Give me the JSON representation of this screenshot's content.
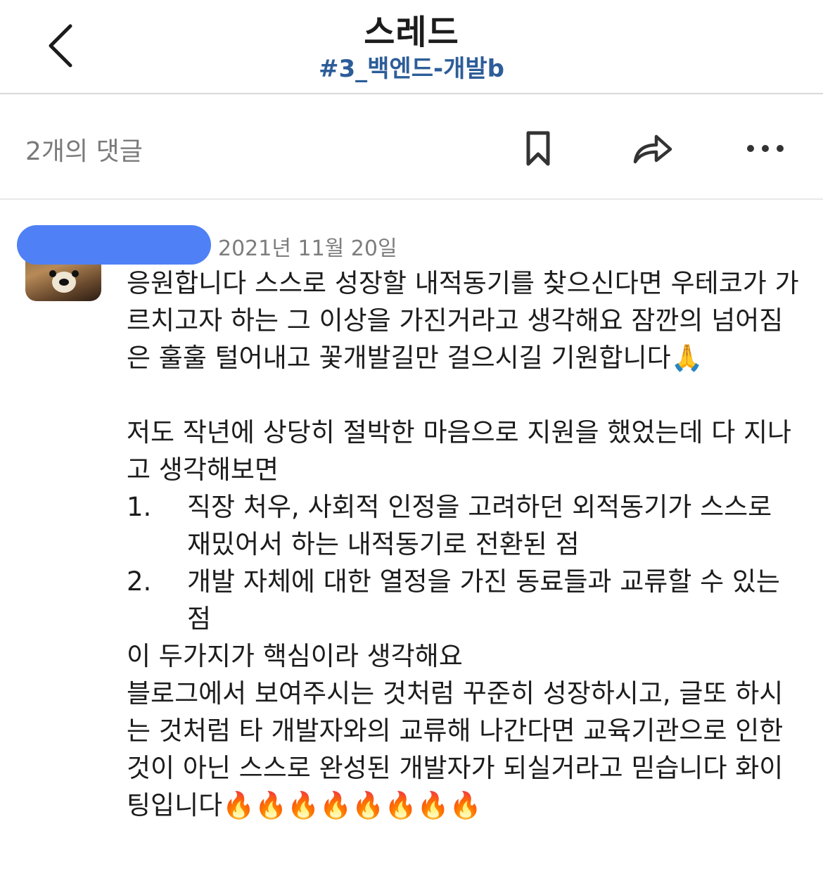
{
  "header": {
    "title": "스레드",
    "channel": "#3_백엔드-개발b"
  },
  "action_bar": {
    "reply_count": "2개의 댓글",
    "icons": [
      "bookmark-icon",
      "share-icon",
      "more-icon"
    ]
  },
  "message": {
    "timestamp": "2021년 11월 20일",
    "paragraph1": "응원합니다 스스로 성장할 내적동기를 찾으신다면 우테코가 가르치고자 하는 그 이상을 가진거라고 생각해요 잠깐의 넘어짐은 훌훌 털어내고 꽃개발길만 걸으시길 기원합니다🙏",
    "paragraph2": "저도 작년에 상당히 절박한 마음으로 지원을 했었는데 다 지나고 생각해보면",
    "list": [
      {
        "num": "1.",
        "text": "직장 처우, 사회적 인정을 고려하던 외적동기가 스스로 재밌어서 하는 내적동기로 전환된 점"
      },
      {
        "num": "2.",
        "text": "개발 자체에 대한 열정을 가진 동료들과 교류할 수 있는 점"
      }
    ],
    "paragraph3": "이 두가지가 핵심이라 생각해요",
    "paragraph4": "블로그에서 보여주시는 것처럼 꾸준히 성장하시고, 글또 하시는 것처럼 타 개발자와의 교류해 나간다면 교육기관으로 인한 것이 아닌 스스로 완성된 개발자가 되실거라고 믿습니다 화이팅입니다🔥🔥🔥🔥🔥🔥🔥🔥"
  },
  "colors": {
    "channel_link": "#2d5d99",
    "redaction": "#4f80f5",
    "muted_text": "#7a7a7a"
  }
}
